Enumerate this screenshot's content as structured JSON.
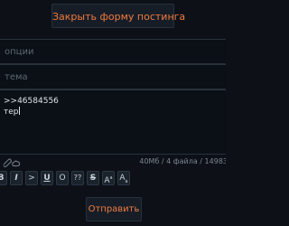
{
  "header": {
    "close_form_label": "Закрыть форму постинга"
  },
  "form": {
    "options_placeholder": "опции",
    "subject_placeholder": "тема",
    "message_line1": ">>46584556",
    "message_line2": "тер",
    "file_info": "40Мб / 4 файла / 14983"
  },
  "toolbar": {
    "buttons": [
      {
        "label": "B",
        "name": "bold-button"
      },
      {
        "label": "I",
        "name": "italic-button"
      },
      {
        "label": ">",
        "name": "quote-button"
      },
      {
        "label": "U",
        "name": "underline-button"
      },
      {
        "label": "O",
        "name": "overline-button"
      },
      {
        "label": "??",
        "name": "spoiler-button"
      },
      {
        "label": "S",
        "name": "strike-button"
      },
      {
        "label": "A",
        "name": "superscript-button"
      },
      {
        "label": "A",
        "name": "subscript-button"
      }
    ]
  },
  "submit": {
    "label": "Отправить"
  },
  "colors": {
    "accent": "#f07a3e",
    "background": "#0d1117",
    "field_bg": "#0b1016",
    "border": "#28313c"
  }
}
